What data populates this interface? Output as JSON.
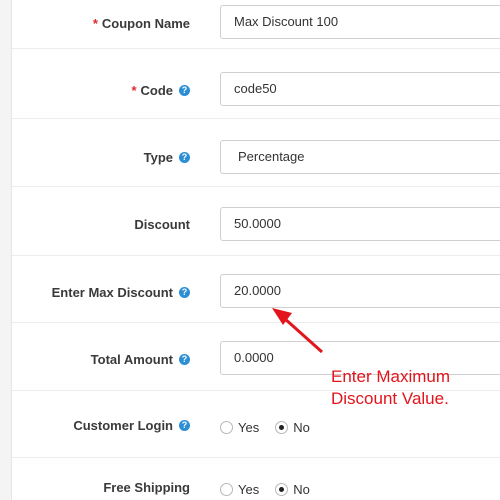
{
  "form": {
    "coupon_name": {
      "label": "Coupon Name",
      "required": "*",
      "value": "Max Discount 100"
    },
    "code": {
      "label": "Code",
      "required": "*",
      "value": "code50",
      "help": "?"
    },
    "type": {
      "label": "Type",
      "value": "Percentage",
      "help": "?"
    },
    "discount": {
      "label": "Discount",
      "value": "50.0000"
    },
    "max_discount": {
      "label": "Enter Max Discount",
      "value": "20.0000",
      "help": "?"
    },
    "total_amount": {
      "label": "Total Amount",
      "value": "0.0000",
      "help": "?"
    },
    "customer_login": {
      "label": "Customer Login",
      "help": "?",
      "yes": "Yes",
      "no": "No",
      "selected": "No"
    },
    "free_shipping": {
      "label": "Free Shipping",
      "yes": "Yes",
      "no": "No",
      "selected": "No"
    }
  },
  "annotation": {
    "line1": "Enter Maximum",
    "line2": "Discount Value.",
    "color": "#e3141b"
  },
  "colors": {
    "help_icon": "#2c8fd6",
    "required": "#e3262b"
  }
}
